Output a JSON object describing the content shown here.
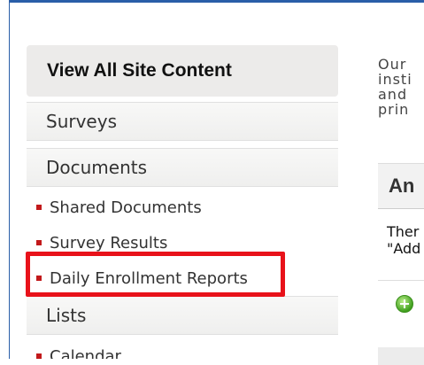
{
  "quick_launch": {
    "header": "View All Site Content",
    "sections": [
      {
        "label": "Surveys",
        "items": []
      },
      {
        "label": "Documents",
        "items": [
          "Shared Documents",
          "Survey Results",
          "Daily Enrollment Reports"
        ]
      },
      {
        "label": "Lists",
        "items": [
          "Calendar"
        ]
      }
    ]
  },
  "main": {
    "intro_lines": [
      "Our",
      "insti",
      "and",
      "prin"
    ],
    "announcements_title": "An",
    "announcement_lines": [
      "Ther",
      "\"Add"
    ]
  },
  "colors": {
    "accent_frame": "#2a5ea8",
    "bullet": "#c2191b",
    "highlight_border": "#e8121a"
  },
  "icons": [
    "add-icon"
  ]
}
